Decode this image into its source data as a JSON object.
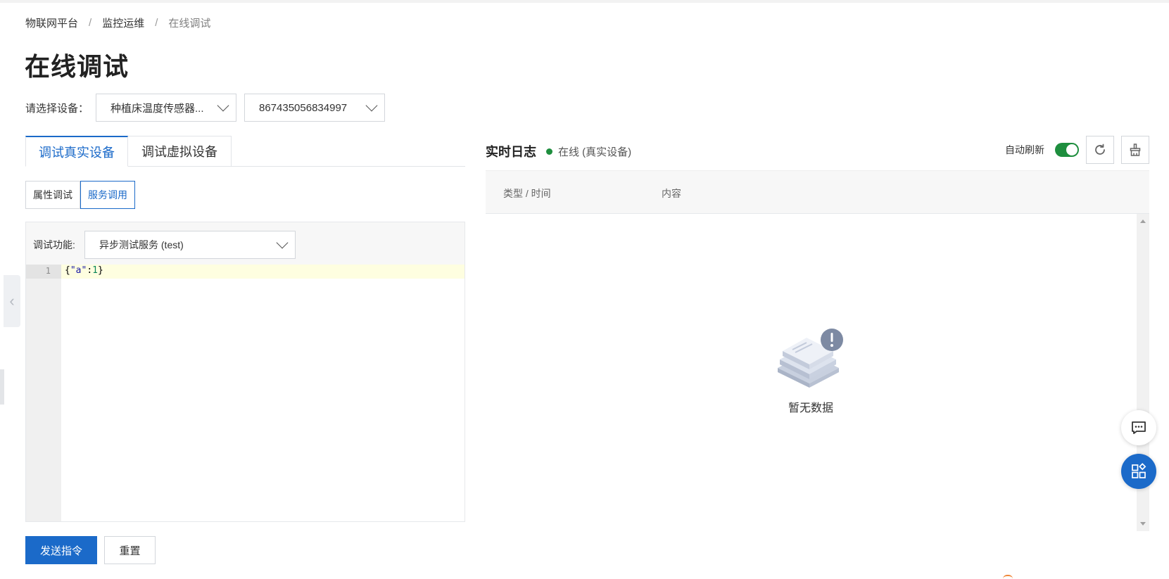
{
  "breadcrumb": {
    "items": [
      "物联网平台",
      "监控运维",
      "在线调试"
    ],
    "separator": "/"
  },
  "page": {
    "title": "在线调试"
  },
  "device_select": {
    "label": "请选择设备：",
    "product_value": "种植床温度传感器...",
    "device_value": "867435056834997"
  },
  "tabs": {
    "real": "调试真实设备",
    "virtual": "调试虚拟设备"
  },
  "subtabs": {
    "property": "属性调试",
    "service": "服务调用"
  },
  "function": {
    "label": "调试功能:",
    "selected": "异步测试服务 (test)"
  },
  "editor": {
    "line_number": "1",
    "code_open": "{",
    "code_key": "\"a\"",
    "code_colon": ":",
    "code_value": "1",
    "code_close": "}"
  },
  "actions": {
    "send": "发送指令",
    "reset": "重置"
  },
  "log": {
    "title": "实时日志",
    "status": "在线 (真实设备)",
    "auto_refresh_label": "自动刷新",
    "auto_refresh_on": true,
    "columns": {
      "type_time": "类型 / 时间",
      "content": "内容"
    },
    "empty_text": "暂无数据"
  },
  "colors": {
    "primary": "#1b6ac9",
    "online": "#1e8e3e",
    "editor_highlight": "#fefee0"
  },
  "icons": {
    "refresh": "refresh-icon",
    "clear": "clear-icon",
    "chat": "chat-icon",
    "apps": "apps-icon",
    "collapse": "chevron-left-icon",
    "empty": "empty-data-icon"
  }
}
